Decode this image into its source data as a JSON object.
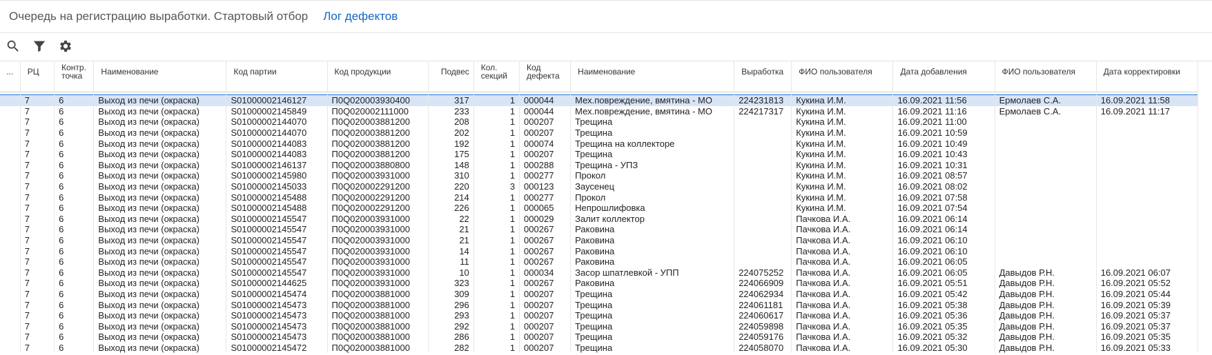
{
  "header": {
    "title": "Очередь на регистрацию выработки. Стартовый отбор",
    "tab_defects": "Лог дефектов"
  },
  "toolbar": {
    "search_icon": "search-icon",
    "filter_icon": "filter-icon",
    "settings_icon": "gear-icon"
  },
  "grid": {
    "marker_header": "...",
    "columns": [
      {
        "key": "rc",
        "label": "РЦ"
      },
      {
        "key": "point",
        "label": "Контр. точка"
      },
      {
        "key": "name",
        "label": "Наименование"
      },
      {
        "key": "batch",
        "label": "Код партии"
      },
      {
        "key": "product",
        "label": "Код продукции"
      },
      {
        "key": "hanger",
        "label": "Подвес"
      },
      {
        "key": "sections",
        "label": "Кол. секций"
      },
      {
        "key": "defect_code",
        "label": "Код дефекта"
      },
      {
        "key": "defect_name",
        "label": "Наименование"
      },
      {
        "key": "output",
        "label": "Выработка"
      },
      {
        "key": "user",
        "label": "ФИО пользователя"
      },
      {
        "key": "date_added",
        "label": "Дата добавления"
      },
      {
        "key": "user2",
        "label": "ФИО пользователя"
      },
      {
        "key": "date_corrected",
        "label": "Дата корректировки"
      }
    ],
    "rows": [
      [
        "7",
        "6",
        "Выход из печи (окраска)",
        "S01000002146127",
        "П0Q020003930400",
        "317",
        "1",
        "000044",
        "Мех.повреждение, вмятина - МО",
        "224231813",
        "Кукина И.М.",
        "16.09.2021 11:56",
        "Ермолаев С.А.",
        "16.09.2021 11:58"
      ],
      [
        "7",
        "6",
        "Выход из печи (окраска)",
        "S01000002145849",
        "П0Q020002111000",
        "233",
        "1",
        "000044",
        "Мех.повреждение, вмятина - МО",
        "224217317",
        "Кукина И.М.",
        "16.09.2021 11:16",
        "Ермолаев С.А.",
        "16.09.2021 11:17"
      ],
      [
        "7",
        "6",
        "Выход из печи (окраска)",
        "S01000002144070",
        "П0Q020003881200",
        "208",
        "1",
        "000207",
        "Трещина",
        "",
        "Кукина И.М.",
        "16.09.2021 11:00",
        "",
        ""
      ],
      [
        "7",
        "6",
        "Выход из печи (окраска)",
        "S01000002144070",
        "П0Q020003881200",
        "202",
        "1",
        "000207",
        "Трещина",
        "",
        "Кукина И.М.",
        "16.09.2021 10:59",
        "",
        ""
      ],
      [
        "7",
        "6",
        "Выход из печи (окраска)",
        "S01000002144083",
        "П0Q020003881200",
        "192",
        "1",
        "000074",
        "Трещина на коллекторе",
        "",
        "Кукина И.М.",
        "16.09.2021 10:49",
        "",
        ""
      ],
      [
        "7",
        "6",
        "Выход из печи (окраска)",
        "S01000002144083",
        "П0Q020003881200",
        "175",
        "1",
        "000207",
        "Трещина",
        "",
        "Кукина И.М.",
        "16.09.2021 10:43",
        "",
        ""
      ],
      [
        "7",
        "6",
        "Выход из печи (окраска)",
        "S01000002146137",
        "П0Q020003880800",
        "148",
        "1",
        "000288",
        "Трещина - УПЗ",
        "",
        "Кукина И.М.",
        "16.09.2021 10:31",
        "",
        ""
      ],
      [
        "7",
        "6",
        "Выход из печи (окраска)",
        "S01000002145980",
        "П0Q020003931000",
        "310",
        "1",
        "000277",
        "Прокол",
        "",
        "Кукина И.М.",
        "16.09.2021 08:57",
        "",
        ""
      ],
      [
        "7",
        "6",
        "Выход из печи (окраска)",
        "S01000002145033",
        "П0Q020002291200",
        "220",
        "3",
        "000123",
        "Заусенец",
        "",
        "Кукина И.М.",
        "16.09.2021 08:02",
        "",
        ""
      ],
      [
        "7",
        "6",
        "Выход из печи (окраска)",
        "S01000002145488",
        "П0Q020002291200",
        "214",
        "1",
        "000277",
        "Прокол",
        "",
        "Кукина И.М.",
        "16.09.2021 07:58",
        "",
        ""
      ],
      [
        "7",
        "6",
        "Выход из печи (окраска)",
        "S01000002145488",
        "П0Q020002291200",
        "226",
        "1",
        "000065",
        "Непрошлифовка",
        "",
        "Кукина И.М.",
        "16.09.2021 07:54",
        "",
        ""
      ],
      [
        "7",
        "6",
        "Выход из печи (окраска)",
        "S01000002145547",
        "П0Q020003931000",
        "22",
        "1",
        "000029",
        "Залит коллектор",
        "",
        "Пачкова И.А.",
        "16.09.2021 06:14",
        "",
        ""
      ],
      [
        "7",
        "6",
        "Выход из печи (окраска)",
        "S01000002145547",
        "П0Q020003931000",
        "21",
        "1",
        "000267",
        "Раковина",
        "",
        "Пачкова И.А.",
        "16.09.2021 06:14",
        "",
        ""
      ],
      [
        "7",
        "6",
        "Выход из печи (окраска)",
        "S01000002145547",
        "П0Q020003931000",
        "21",
        "1",
        "000267",
        "Раковина",
        "",
        "Пачкова И.А.",
        "16.09.2021 06:10",
        "",
        ""
      ],
      [
        "7",
        "6",
        "Выход из печи (окраска)",
        "S01000002145547",
        "П0Q020003931000",
        "14",
        "1",
        "000267",
        "Раковина",
        "",
        "Пачкова И.А.",
        "16.09.2021 06:10",
        "",
        ""
      ],
      [
        "7",
        "6",
        "Выход из печи (окраска)",
        "S01000002145547",
        "П0Q020003931000",
        "11",
        "1",
        "000267",
        "Раковина",
        "",
        "Пачкова И.А.",
        "16.09.2021 06:05",
        "",
        ""
      ],
      [
        "7",
        "6",
        "Выход из печи (окраска)",
        "S01000002145547",
        "П0Q020003931000",
        "10",
        "1",
        "000034",
        "Засор шпатлевкой - УПП",
        "224075252",
        "Пачкова И.А.",
        "16.09.2021 06:05",
        "Давыдов Р.Н.",
        "16.09.2021 06:07"
      ],
      [
        "7",
        "6",
        "Выход из печи (окраска)",
        "S01000002144625",
        "П0Q020003931000",
        "323",
        "1",
        "000267",
        "Раковина",
        "224066909",
        "Пачкова И.А.",
        "16.09.2021 05:51",
        "Давыдов Р.Н.",
        "16.09.2021 05:52"
      ],
      [
        "7",
        "6",
        "Выход из печи (окраска)",
        "S01000002145474",
        "П0Q020003881000",
        "309",
        "1",
        "000207",
        "Трещина",
        "224062934",
        "Пачкова И.А.",
        "16.09.2021 05:42",
        "Давыдов Р.Н.",
        "16.09.2021 05:44"
      ],
      [
        "7",
        "6",
        "Выход из печи (окраска)",
        "S01000002145473",
        "П0Q020003881000",
        "296",
        "1",
        "000207",
        "Трещина",
        "224061181",
        "Пачкова И.А.",
        "16.09.2021 05:38",
        "Давыдов Р.Н.",
        "16.09.2021 05:39"
      ],
      [
        "7",
        "6",
        "Выход из печи (окраска)",
        "S01000002145473",
        "П0Q020003881000",
        "293",
        "1",
        "000207",
        "Трещина",
        "224060617",
        "Пачкова И.А.",
        "16.09.2021 05:36",
        "Давыдов Р.Н.",
        "16.09.2021 05:37"
      ],
      [
        "7",
        "6",
        "Выход из печи (окраска)",
        "S01000002145473",
        "П0Q020003881000",
        "292",
        "1",
        "000207",
        "Трещина",
        "224059898",
        "Пачкова И.А.",
        "16.09.2021 05:35",
        "Давыдов Р.Н.",
        "16.09.2021 05:37"
      ],
      [
        "7",
        "6",
        "Выход из печи (окраска)",
        "S01000002145473",
        "П0Q020003881000",
        "286",
        "1",
        "000207",
        "Трещина",
        "224059176",
        "Пачкова И.А.",
        "16.09.2021 05:32",
        "Давыдов Р.Н.",
        "16.09.2021 05:35"
      ],
      [
        "7",
        "6",
        "Выход из печи (окраска)",
        "S01000002145472",
        "П0Q020003881000",
        "282",
        "1",
        "000207",
        "Трещина",
        "224058070",
        "Пачкова И.А.",
        "16.09.2021 05:30",
        "Давыдов Р.Н.",
        "16.09.2021 05:33"
      ]
    ],
    "selected_row": 0,
    "colors": {
      "selected_bg": "#d8e5f7",
      "selected_border": "#1976d2",
      "link": "#1565c0"
    }
  }
}
